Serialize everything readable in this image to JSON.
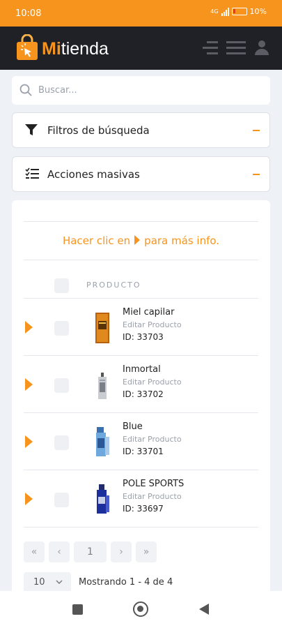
{
  "status_bar": {
    "time": "10:08",
    "network": "4G",
    "battery": "10%"
  },
  "app": {
    "brand_highlight": "Mi",
    "brand_rest": "tienda",
    "accent_color": "#f7941d",
    "header_color": "#1f2126"
  },
  "search": {
    "placeholder": "Buscar..."
  },
  "panels": {
    "filters": {
      "label": "Filtros de búsqueda",
      "icon": "funnel-icon"
    },
    "bulk_actions": {
      "label": "Acciones masivas",
      "icon": "checklist-icon"
    }
  },
  "hint": {
    "before": "Hacer clic en",
    "after": "para más info."
  },
  "table": {
    "column_header": "PRODUCTO",
    "rows": [
      {
        "name": "Miel capilar",
        "edit": "Editar Producto",
        "id": "ID: 33703"
      },
      {
        "name": "Inmortal",
        "edit": "Editar Producto",
        "id": "ID: 33702"
      },
      {
        "name": "Blue",
        "edit": "Editar Producto",
        "id": "ID: 33701"
      },
      {
        "name": "POLE SPORTS",
        "edit": "Editar Producto",
        "id": "ID: 33697"
      }
    ]
  },
  "pagination": {
    "first": "«",
    "prev": "‹",
    "current_page": "1",
    "next": "›",
    "last": "»"
  },
  "footer": {
    "per_page": "10",
    "showing": "Mostrando 1 - 4 de 4"
  }
}
